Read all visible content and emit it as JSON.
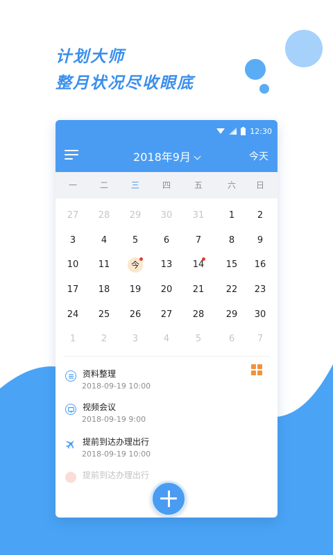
{
  "headline": {
    "line1": "计划大师",
    "line2": "整月状况尽收眼底"
  },
  "colors": {
    "brand_blue": "#4a9cf3",
    "accent_orange": "#f0923c",
    "event_dot": "#e53b2e",
    "today_bg": "#fbe7cd"
  },
  "status_bar": {
    "time": "12:30",
    "icons": [
      "wifi-icon",
      "signal-icon",
      "battery-icon"
    ]
  },
  "app_bar": {
    "menu_icon": "hamburger-menu-icon",
    "month_title": "2018年9月",
    "today_button": "今天"
  },
  "calendar": {
    "weekdays": [
      "一",
      "二",
      "三",
      "四",
      "五",
      "六",
      "日"
    ],
    "current_weekday_index": 2,
    "weeks": [
      [
        {
          "d": "27",
          "dim": true
        },
        {
          "d": "28",
          "dim": true
        },
        {
          "d": "29",
          "dim": true
        },
        {
          "d": "30",
          "dim": true
        },
        {
          "d": "31",
          "dim": true
        },
        {
          "d": "1"
        },
        {
          "d": "2"
        }
      ],
      [
        {
          "d": "3"
        },
        {
          "d": "4"
        },
        {
          "d": "5"
        },
        {
          "d": "6"
        },
        {
          "d": "7"
        },
        {
          "d": "8"
        },
        {
          "d": "9"
        }
      ],
      [
        {
          "d": "10"
        },
        {
          "d": "11"
        },
        {
          "d": "今",
          "today": true,
          "mark": true
        },
        {
          "d": "13"
        },
        {
          "d": "14",
          "mark": true
        },
        {
          "d": "15"
        },
        {
          "d": "16"
        }
      ],
      [
        {
          "d": "17"
        },
        {
          "d": "18"
        },
        {
          "d": "19"
        },
        {
          "d": "20"
        },
        {
          "d": "21"
        },
        {
          "d": "22"
        },
        {
          "d": "23"
        }
      ],
      [
        {
          "d": "24"
        },
        {
          "d": "25"
        },
        {
          "d": "26"
        },
        {
          "d": "27"
        },
        {
          "d": "28"
        },
        {
          "d": "29"
        },
        {
          "d": "30"
        }
      ],
      [
        {
          "d": "1",
          "dim": true
        },
        {
          "d": "2",
          "dim": true
        },
        {
          "d": "3",
          "dim": true
        },
        {
          "d": "4",
          "dim": true
        },
        {
          "d": "5",
          "dim": true
        },
        {
          "d": "6",
          "dim": true
        },
        {
          "d": "7",
          "dim": true
        }
      ]
    ]
  },
  "events": [
    {
      "title": "资料整理",
      "time": "2018-09-19   10:00",
      "icon": "document-icon"
    },
    {
      "title": "视频会议",
      "time": "2018-09-19   9:00",
      "icon": "video-icon"
    },
    {
      "title": "提前到达办理出行",
      "time": "2018-09-19   10:00",
      "icon": "airplane-icon"
    },
    {
      "title": "提前到达办理出行",
      "time": "",
      "icon": "event-icon",
      "faded": true
    }
  ],
  "view_toggle_icon": "grid-view-icon",
  "fab_icon": "plus-icon"
}
